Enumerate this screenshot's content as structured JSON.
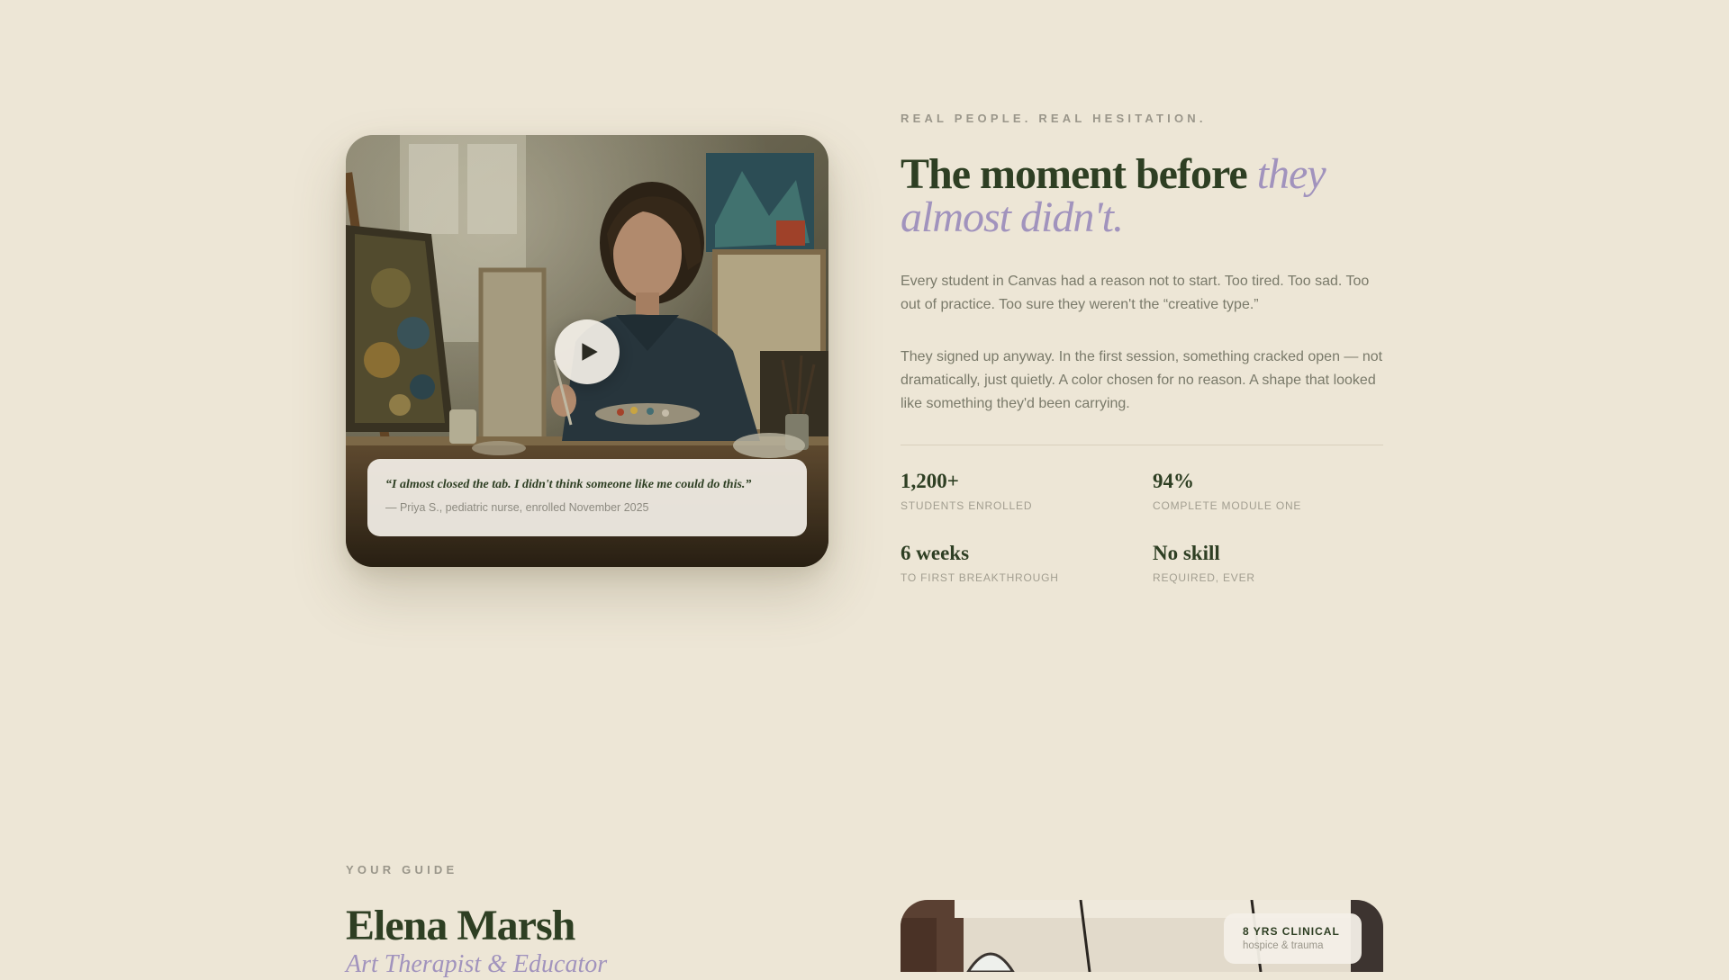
{
  "testimonial": {
    "quote": "“I almost closed the tab. I didn't think someone like me could do this.”",
    "attribution": "— Priya S., pediatric nurse, enrolled November 2025"
  },
  "story": {
    "eyebrow": "REAL PEOPLE. REAL HESITATION.",
    "headline_main": "The moment before ",
    "headline_accent": "they almost didn't.",
    "paragraph_1": "Every student in Canvas had a reason not to start. Too tired. Too sad. Too out of practice. Too sure they weren't the “creative type.”",
    "paragraph_2": "They signed up anyway. In the first session, something cracked open — not dramatically, just quietly. A color chosen for no reason. A shape that looked like something they'd been carrying.",
    "stats": [
      {
        "value": "1,200+",
        "label": "STUDENTS ENROLLED"
      },
      {
        "value": "94%",
        "label": "COMPLETE MODULE ONE"
      },
      {
        "value": "6 weeks",
        "label": "TO FIRST BREAKTHROUGH"
      },
      {
        "value": "No skill",
        "label": "REQUIRED, EVER"
      }
    ]
  },
  "guide": {
    "eyebrow": "YOUR GUIDE",
    "name": "Elena Marsh",
    "role": "Art Therapist & Educator",
    "badge_title": "8 YRS CLINICAL",
    "badge_sub": "hospice & trauma"
  },
  "colors": {
    "background": "#ede6d6",
    "heading_green": "#2e3f23",
    "accent_lavender": "#a193bd",
    "body_text": "#7a7a6a"
  }
}
